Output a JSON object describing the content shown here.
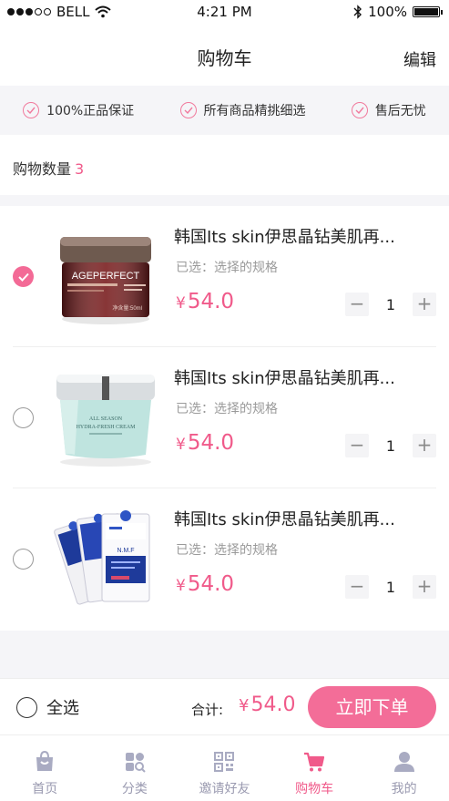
{
  "status_bar": {
    "carrier": "BELL",
    "time": "4:21 PM",
    "battery": "100%"
  },
  "nav": {
    "title": "购物车",
    "edit_label": "编辑"
  },
  "guarantees": [
    "100%正品保证",
    "所有商品精挑细选",
    "售后无忧"
  ],
  "cart_count": {
    "label": "购物数量",
    "value": "3"
  },
  "cart_items": [
    {
      "name": "韩国Its skin伊思晶钻美肌再...",
      "spec": "已选：选择的规格",
      "currency": "¥",
      "price": "54.0",
      "quantity": "1",
      "selected": true,
      "image": "ageperfect-jar"
    },
    {
      "name": "韩国Its skin伊思晶钻美肌再...",
      "spec": "已选：选择的规格",
      "currency": "¥",
      "price": "54.0",
      "quantity": "1",
      "selected": false,
      "image": "hydra-cream-jar"
    },
    {
      "name": "韩国Its skin伊思晶钻美肌再...",
      "spec": "已选：选择的规格",
      "currency": "¥",
      "price": "54.0",
      "quantity": "1",
      "selected": false,
      "image": "mask-packs"
    }
  ],
  "product_image_text": {
    "ageperfect": "AGEPERFECT",
    "volume": "净含量:50ml",
    "hydra_line1": "ALL SEASON",
    "hydra_line2": "HYDRA-FRESH CREAM",
    "nmf": "N.M.F"
  },
  "stepper": {
    "minus": "−",
    "plus": "+"
  },
  "checkout": {
    "select_all_label": "全选",
    "total_label": "合计:",
    "currency": "¥",
    "total_value": "54.0",
    "order_button_label": "立即下单"
  },
  "tabs": [
    {
      "label": "首页",
      "icon": "home-bag-icon",
      "active": false
    },
    {
      "label": "分类",
      "icon": "category-grid-icon",
      "active": false
    },
    {
      "label": "邀请好友",
      "icon": "qr-code-icon",
      "active": false
    },
    {
      "label": "购物车",
      "icon": "shopping-cart-icon",
      "active": true
    },
    {
      "label": "我的",
      "icon": "user-icon",
      "active": false
    }
  ],
  "colors": {
    "accent": "#f05a8a",
    "button": "#f36d98",
    "tab_inactive": "#9a9ab0",
    "band": "#f5f5f8"
  }
}
